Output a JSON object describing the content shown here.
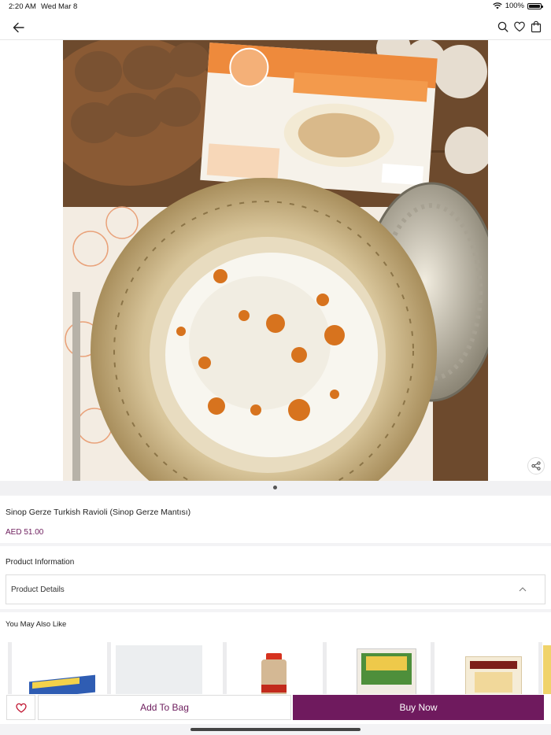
{
  "status": {
    "time": "2:20 AM",
    "date": "Wed Mar 8",
    "battery": "100%"
  },
  "header": {
    "icons": [
      "back-arrow-icon",
      "search-icon",
      "heart-icon",
      "bag-icon"
    ]
  },
  "gallery": {
    "page_count": 1,
    "active_page": 1,
    "image_alt": "Sinop Gerze Turkish Ravioli product photo"
  },
  "product": {
    "title": "Sinop Gerze Turkish Ravioli (Sinop Gerze Mantısı)",
    "price": "AED 51.00"
  },
  "product_info": {
    "heading": "Product Information",
    "details_label": "Product Details"
  },
  "also_like": {
    "heading": "You May Also Like"
  },
  "actions": {
    "add_to_bag": "Add To Bag",
    "buy_now": "Buy Now"
  },
  "colors": {
    "brand": "#6f1a5e",
    "price": "#6c1c5c"
  }
}
